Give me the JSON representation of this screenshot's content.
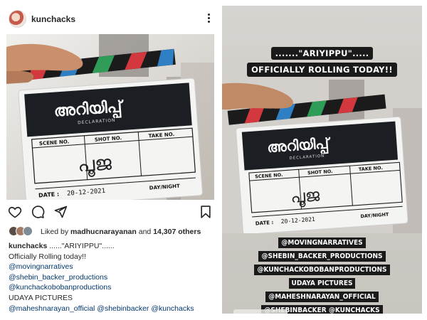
{
  "post": {
    "username": "kunchacks",
    "likes": {
      "prefix": "Liked by ",
      "liker": "madhucnarayanan",
      "suffix": " and ",
      "others": "14,307 others"
    },
    "caption": {
      "user": "kunchacks",
      "first_line": " ......\"ARIYIPPU\"......",
      "lines": [
        "Officially Rolling today!!",
        "@movingnarratives",
        "@shebin_backer_productions",
        "@kunchackobobanproductions",
        "UDAYA PICTURES",
        "@maheshnarayan_official @shebinbacker @kunchacks"
      ]
    }
  },
  "clapboard": {
    "title": "അറിയിപ്പ്",
    "subtitle": "DECLARATION",
    "scene_label": "SCENE NO.",
    "shot_label": "SHOT NO.",
    "take_label": "TAKE NO.",
    "day_label": "DAY/NIGHT",
    "date_label": "DATE :",
    "date_value": "20-12-2021",
    "word": "പൂജ"
  },
  "story": {
    "title_line1": ".......\"ARIYIPPU\".....",
    "title_line2": "OFFICIALLY ROLLING TODAY!!",
    "mentions": [
      "@MOVINGNARRATIVES",
      "@SHEBIN_BACKER_PRODUCTIONS",
      "@KUNCHACKOBOBANPRODUCTIONS",
      "UDAYA PICTURES",
      "@MAHESHNARAYAN_OFFICIAL",
      "@SHEBINBACKER @KUNCHACKS"
    ]
  },
  "icons": {
    "more": "more-vertical-icon",
    "like": "heart-icon",
    "comment": "comment-icon",
    "share": "send-icon",
    "save": "bookmark-icon"
  },
  "colors": {
    "link": "#00376b",
    "text": "#262626",
    "story_tag_bg": "#1a1a1a",
    "clap_green": "#2f9d58",
    "clap_red": "#d2383e",
    "clap_blue": "#2f7fc4"
  }
}
